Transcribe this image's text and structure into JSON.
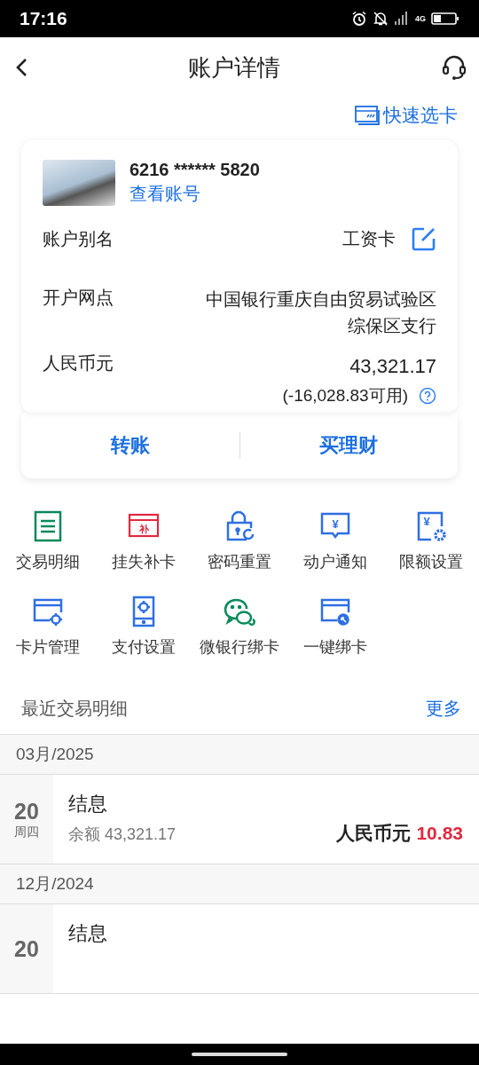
{
  "status_bar": {
    "time": "17:16",
    "network": "4G"
  },
  "header": {
    "title": "账户详情"
  },
  "quick_select": {
    "label": "快速选卡"
  },
  "card": {
    "number": "6216 ****** 5820",
    "view_link": "查看账号",
    "fields": [
      {
        "kind": "editable",
        "label": "账户别名",
        "value": "工资卡"
      },
      {
        "kind": "text",
        "label": "开户网点",
        "value": "中国银行重庆自由贸易试验区综保区支行"
      },
      {
        "kind": "balance",
        "label": "人民币元",
        "value": "43,321.17",
        "sub": "(-16,028.83可用)"
      }
    ],
    "actions": [
      "转账",
      "买理财"
    ]
  },
  "services": [
    {
      "kind": "list",
      "label": "交易明细",
      "color": "#0a8a5a"
    },
    {
      "kind": "reissue",
      "label": "挂失补卡",
      "color": "#e0293f",
      "icon_text": "补"
    },
    {
      "kind": "lock",
      "label": "密码重置",
      "color": "#2f6fe4"
    },
    {
      "kind": "notice",
      "label": "动户通知",
      "color": "#2f6fe4",
      "icon_text": "¥"
    },
    {
      "kind": "limit",
      "label": "限额设置",
      "color": "#2f6fe4",
      "icon_text": "¥"
    },
    {
      "kind": "cardgear",
      "label": "卡片管理",
      "color": "#2f6fe4"
    },
    {
      "kind": "phone",
      "label": "支付设置",
      "color": "#2f6fe4"
    },
    {
      "kind": "chat",
      "label": "微银行绑卡",
      "color": "#0a8a5a"
    },
    {
      "kind": "cardlink",
      "label": "一键绑卡",
      "color": "#2f6fe4"
    }
  ],
  "recent": {
    "title": "最近交易明细",
    "more": "更多",
    "months": [
      {
        "month": "03月/2025",
        "entries": [
          {
            "day": "20",
            "weekday": "周四",
            "title": "结息",
            "balance": "余额 43,321.17",
            "currency": "人民币元",
            "amount": "10.83"
          }
        ]
      },
      {
        "month": "12月/2024",
        "entries": [
          {
            "day": "20",
            "title": "结息"
          }
        ]
      }
    ]
  }
}
